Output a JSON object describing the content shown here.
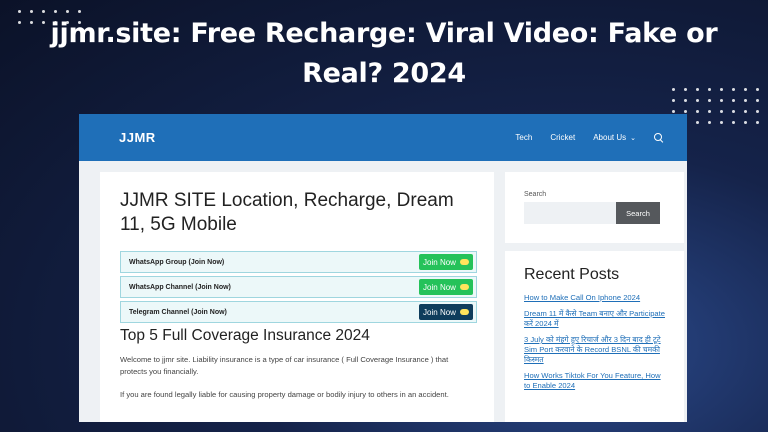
{
  "banner": {
    "headline_line1": "jjmr.site: Free Recharge: Viral Video: Fake or",
    "headline_line2": "Real? 2024"
  },
  "nav": {
    "logo": "JJMR",
    "items": [
      {
        "label": "Tech"
      },
      {
        "label": "Cricket"
      },
      {
        "label": "About Us"
      }
    ],
    "search_icon": "search-icon"
  },
  "main": {
    "post_title": "JJMR SITE Location, Recharge, Dream 11, 5G Mobile",
    "join_rows": [
      {
        "label": "WhatsApp Group (Join Now)",
        "button": "Join Now",
        "color": "#25c25a"
      },
      {
        "label": "WhatsApp Channel (Join Now)",
        "button": "Join Now",
        "color": "#25c25a"
      },
      {
        "label": "Telegram Channel (Join Now)",
        "button": "Join Now",
        "color": "#0f3d5c"
      }
    ],
    "section_title": "Top 5 Full Coverage Insurance 2024",
    "paragraphs": [
      "Welcome to jjmr site. Liability insurance is a type of car insurance ( Full Coverage Insurance ) that protects you financially.",
      "If you are found legally liable for causing property damage or bodily injury to others in an accident."
    ]
  },
  "sidebar": {
    "search_label": "Search",
    "search_button": "Search",
    "recent_title": "Recent Posts",
    "posts": [
      {
        "title": "How to Make Call On Iphone 2024"
      },
      {
        "title": "Dream 11 में कैसे Team बनाए और Participate करें 2024 में"
      },
      {
        "title": "3 July को मंहगे हुए रिचार्ज और 3 दिन बाद ही टूटे Sim Port करवाने के Record BSNL की चमकी किस्मत"
      },
      {
        "title": "How Works Tiktok For You Feature, How to Enable 2024"
      }
    ]
  },
  "colors": {
    "nav_bg": "#1f6fb8",
    "link": "#1f6fb8",
    "whatsapp": "#25c25a",
    "telegram": "#0f3d5c"
  }
}
